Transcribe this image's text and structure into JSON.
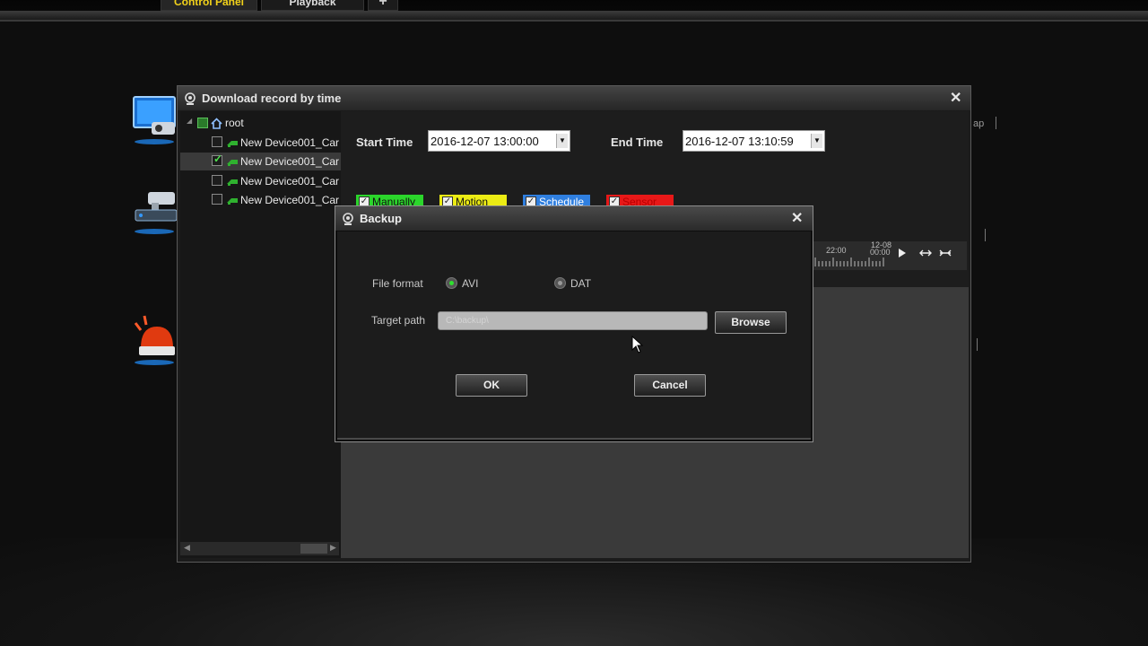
{
  "top_tabs": {
    "active": "Control Panel",
    "other": "Playback",
    "add": "+"
  },
  "right_edge_text": "ap",
  "download_window": {
    "title": "Download record by time",
    "close": "✕",
    "tree": {
      "root": "root",
      "devices": [
        "New Device001_Car",
        "New Device001_Car",
        "New Device001_Car",
        "New Device001_Car"
      ],
      "selected_index": 1
    },
    "start_label": "Start Time",
    "start_value": "2016-12-07 13:00:00",
    "end_label": "End Time",
    "end_value": "2016-12-07 13:10:59",
    "record_types": [
      {
        "label": "Manually",
        "color": "#2bd62b",
        "text_color": "#111111"
      },
      {
        "label": "Motion",
        "color": "#ecec14",
        "text_color": "#111111"
      },
      {
        "label": "Schedule",
        "color": "#2f7fe0",
        "text_color": "#ffffff"
      },
      {
        "label": "Sensor",
        "color": "#e81818",
        "text_color": "#b80000"
      }
    ],
    "timeline": {
      "t1": "22:00",
      "t2_top": "12-08",
      "t2_bottom": "00:00"
    }
  },
  "backup_dialog": {
    "title": "Backup",
    "close": "✕",
    "file_format_label": "File format",
    "formats": [
      {
        "label": "AVI",
        "selected": true
      },
      {
        "label": "DAT",
        "selected": false
      }
    ],
    "target_path_label": "Target path",
    "target_path_value": "C:\\backup\\",
    "browse_label": "Browse",
    "ok_label": "OK",
    "cancel_label": "Cancel"
  }
}
